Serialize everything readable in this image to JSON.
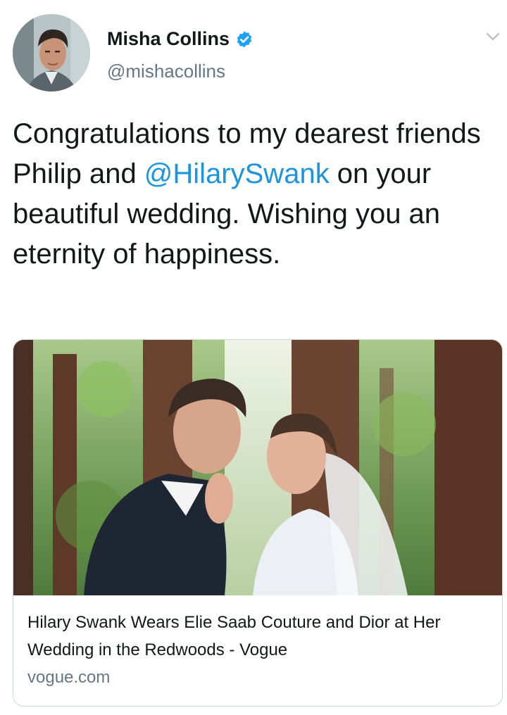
{
  "author": {
    "display_name": "Misha Collins",
    "handle": "@mishacollins",
    "verified": true,
    "verified_color": "#1da1f2"
  },
  "tweet": {
    "text_before_mention": "Congratulations to my dearest friends Philip and ",
    "mention": "@HilarySwank",
    "text_after_mention": " on your beautiful wedding. Wishing you an eternity of happiness.",
    "mention_color": "#1b95e0"
  },
  "link_card": {
    "title": "Hilary Swank Wears Elie Saab Couture and Dior at Her Wedding in the Redwoods - Vogue",
    "domain": "vogue.com"
  },
  "icons": {
    "menu": "chevron-down-icon",
    "badge": "verified-badge-icon"
  }
}
